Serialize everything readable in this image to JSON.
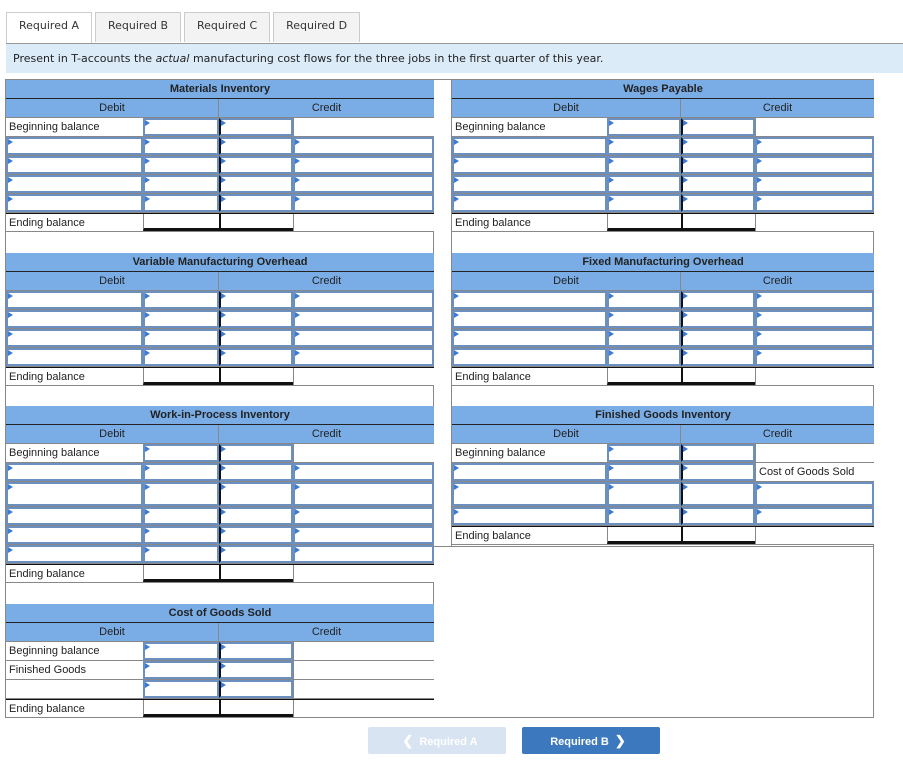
{
  "tabs": [
    {
      "label": "Required A",
      "active": true
    },
    {
      "label": "Required B",
      "active": false
    },
    {
      "label": "Required C",
      "active": false
    },
    {
      "label": "Required D",
      "active": false
    }
  ],
  "instruction": {
    "before": "Present in T-accounts the ",
    "emphasis": "actual",
    "after": " manufacturing cost flows for the three jobs in the first quarter of this year."
  },
  "columns": {
    "debit": "Debit",
    "credit": "Credit"
  },
  "labels": {
    "beginning": "Beginning balance",
    "ending": "Ending balance",
    "finished_goods": "Finished Goods",
    "cost_of_goods_sold": "Cost of Goods Sold"
  },
  "accounts": {
    "materials": {
      "title": "Materials Inventory"
    },
    "wages": {
      "title": "Wages Payable"
    },
    "variable_oh": {
      "title": "Variable Manufacturing Overhead"
    },
    "fixed_oh": {
      "title": "Fixed Manufacturing Overhead"
    },
    "wip": {
      "title": "Work-in-Process Inventory"
    },
    "finished_goods": {
      "title": "Finished Goods Inventory"
    },
    "cogs": {
      "title": "Cost of Goods Sold"
    }
  },
  "nav": {
    "prev_label": "Required A",
    "next_label": "Required B",
    "prev_icon": "chevron-left-icon",
    "next_icon": "chevron-right-icon"
  }
}
